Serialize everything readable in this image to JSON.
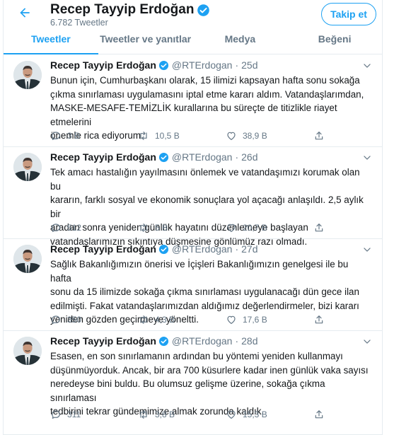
{
  "header": {
    "name": "Recep Tayyip Erdoğan",
    "tweet_count": "6.782 Tweetler",
    "follow_label": "Takip et"
  },
  "tabs": [
    {
      "label": "Tweetler",
      "active": true
    },
    {
      "label": "Tweetler ve yanıtlar",
      "active": false
    },
    {
      "label": "Medya",
      "active": false
    },
    {
      "label": "Beğeni",
      "active": false
    }
  ],
  "colors": {
    "accent": "#1da1f2",
    "muted": "#657786",
    "border": "#e6ecf0"
  },
  "tweets": [
    {
      "name": "Recep Tayyip Erdoğan",
      "handle": "@RTErdogan",
      "dot": "·",
      "time": "25d",
      "lines": [
        "Bunun için, Cumhurbaşkanı olarak, 15 ilimizi kapsayan hafta sonu sokağa",
        "çıkma sınırlaması uygulamasını iptal etme kararı aldım. Vatandaşlarımdan,",
        "MASKE-MESAFE-TEMİZLİK kurallarına bu süreçte de titizlikle riayet etmelerini",
        "önemle rica ediyorum."
      ],
      "replies": "3 B",
      "retweets": "10,5 B",
      "likes": "38,9 B"
    },
    {
      "name": "Recep Tayyip Erdoğan",
      "handle": "@RTErdogan",
      "dot": "·",
      "time": "26d",
      "lines": [
        "Tek amacı hastalığın yayılmasını önlemek ve vatandaşımızı korumak olan bu",
        "kararın, farklı sosyal ve ekonomik sonuçlara yol açacağı anlaşıldı. 2,5 aylık bir",
        "aradan sonra yeniden günlük hayatını düzenlemeye başlayan",
        "vatandaşlarımızın sıkıntıya düşmesine gönlümüz razı olmadı."
      ],
      "replies": "512",
      "retweets": "5 B",
      "likes": "20,7 B"
    },
    {
      "name": "Recep Tayyip Erdoğan",
      "handle": "@RTErdogan",
      "dot": "·",
      "time": "27d",
      "lines": [
        "Sağlık Bakanlığımızın önerisi ve İçişleri Bakanlığımızın genelgesi ile bu hafta",
        "sonu da 15 ilimizde sokağa çıkma sınırlaması uygulanacağı dün gece ilan",
        "edilmişti. Fakat vatandaşlarımızdan aldığımız değerlendirmeler, bizi kararı",
        "yeniden gözden geçirmeye yöneltti."
      ],
      "replies": "350",
      "retweets": "4,3 B",
      "likes": "17,6 B"
    },
    {
      "name": "Recep Tayyip Erdoğan",
      "handle": "@RTErdogan",
      "dot": "·",
      "time": "28d",
      "lines": [
        "Esasen, en son sınırlamanın ardından bu yöntemi yeniden kullanmayı",
        "düşünmüyorduk. Ancak, bir ara 700 küsurlere kadar inen günlük vaka sayısı",
        "neredeyse bini buldu. Bu olumsuz gelişme üzerine, sokağa çıkma sınırlaması",
        "tedbirini tekrar gündemimize almak zorunda kaldık."
      ],
      "replies": "311",
      "retweets": "3,8 B",
      "likes": "15,3 B"
    }
  ]
}
